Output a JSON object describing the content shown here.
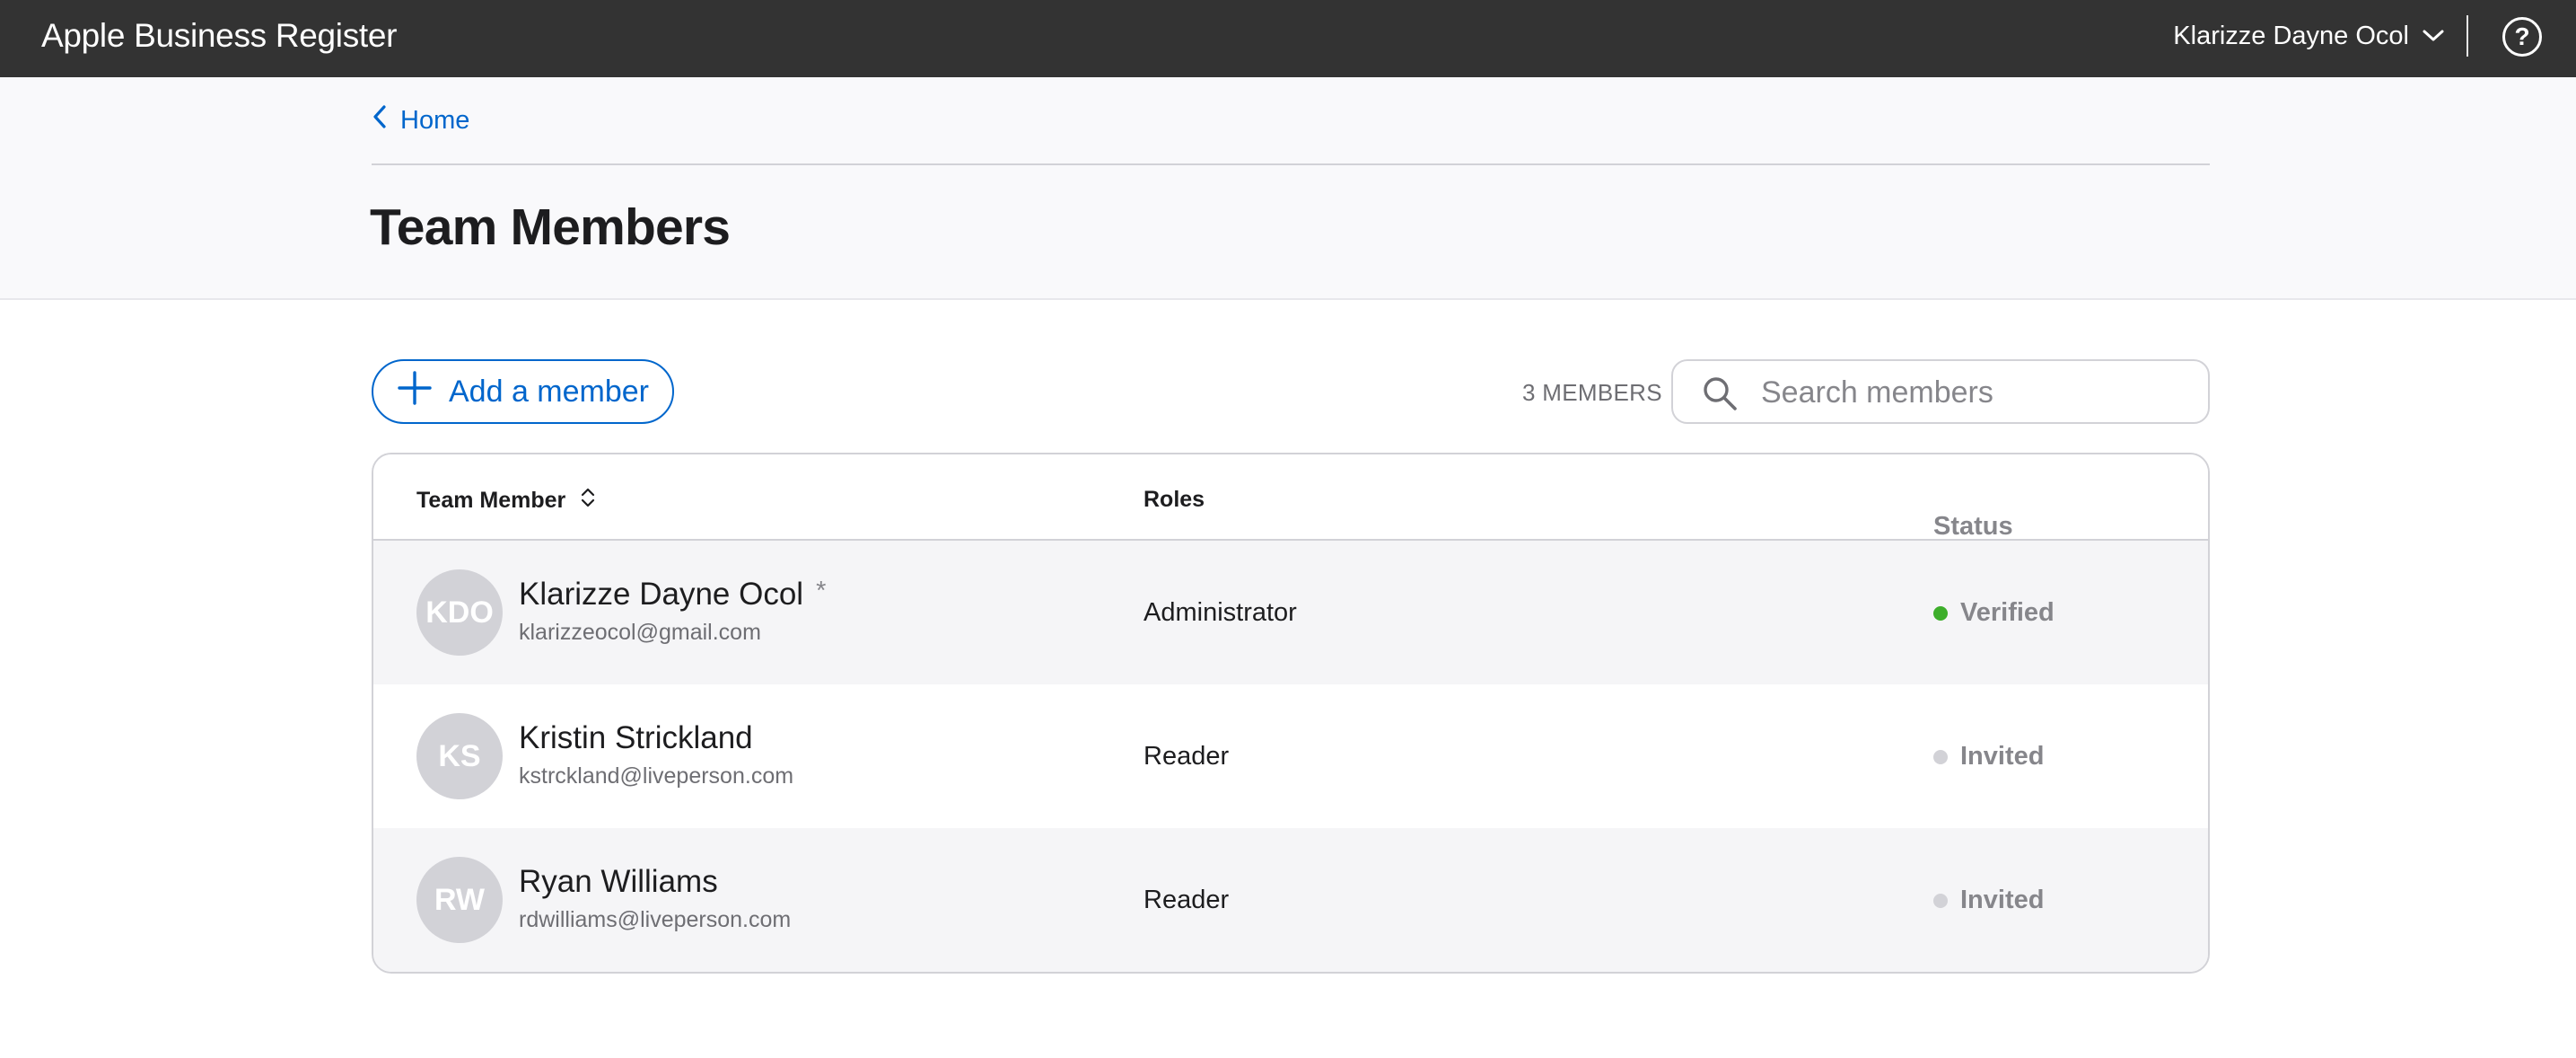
{
  "app": {
    "title": "Apple Business Register"
  },
  "header": {
    "user_name": "Klarizze Dayne Ocol",
    "icons": {
      "user_menu": "chevron-down-icon",
      "help": "help-circle-icon"
    },
    "help_glyph": "?"
  },
  "breadcrumb": {
    "back_label": "Home",
    "icon": "chevron-left-icon"
  },
  "page": {
    "title": "Team Members"
  },
  "toolbar": {
    "add_label": "Add a member",
    "member_count": "3 MEMBERS",
    "search_placeholder": "Search members",
    "search_value": ""
  },
  "table": {
    "columns": {
      "member": "Team Member",
      "roles": "Roles",
      "status": "Status"
    },
    "rows": [
      {
        "initials": "KDO",
        "name": "Klarizze Dayne Ocol",
        "marker": "*",
        "email": "klarizzeocol@gmail.com",
        "role": "Administrator",
        "status": "Verified",
        "status_color": "#3dae2b"
      },
      {
        "initials": "KS",
        "name": "Kristin Strickland",
        "marker": "",
        "email": "kstrckland@liveperson.com",
        "role": "Reader",
        "status": "Invited",
        "status_color": "#d2d2d7"
      },
      {
        "initials": "RW",
        "name": "Ryan Williams",
        "marker": "",
        "email": "rdwilliams@liveperson.com",
        "role": "Reader",
        "status": "Invited",
        "status_color": "#d2d2d7"
      }
    ]
  },
  "colors": {
    "topbar": "#333333",
    "accent": "#0066cc",
    "verified": "#3dae2b",
    "invited": "#d2d2d7",
    "row_alt": "#f5f5f7"
  }
}
